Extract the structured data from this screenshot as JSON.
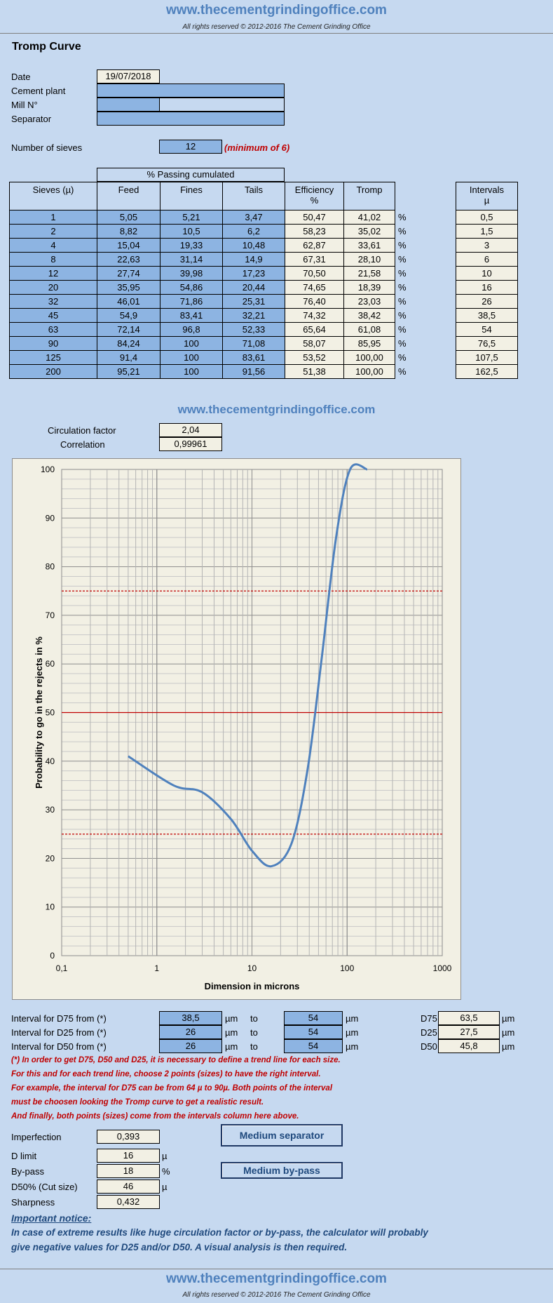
{
  "header": {
    "url": "www.thecementgrindingoffice.com",
    "copyright": "All rights reserved © 2012-2016 The Cement Grinding Office"
  },
  "title": "Tromp Curve",
  "info": {
    "date_label": "Date",
    "date_value": "19/07/2018",
    "plant_label": "Cement plant",
    "plant_value": "",
    "mill_label": "Mill N°",
    "mill_value": "",
    "separator_label": "Separator",
    "separator_value": ""
  },
  "sieves": {
    "label": "Number of sieves",
    "value": "12",
    "note": "(minimum of 6)"
  },
  "table": {
    "group_header": "% Passing cumulated",
    "headers": {
      "sieves": "Sieves (µ)",
      "feed": "Feed",
      "fines": "Fines",
      "tails": "Tails",
      "efficiency": "Efficiency",
      "efficiency_unit": "%",
      "tromp": "Tromp",
      "intervals": "Intervals",
      "intervals_unit": "µ"
    },
    "pct": "%",
    "rows": [
      {
        "sieve": "1",
        "feed": "5,05",
        "fines": "5,21",
        "tails": "3,47",
        "eff": "50,47",
        "tromp": "41,02",
        "interval": "0,5"
      },
      {
        "sieve": "2",
        "feed": "8,82",
        "fines": "10,5",
        "tails": "6,2",
        "eff": "58,23",
        "tromp": "35,02",
        "interval": "1,5"
      },
      {
        "sieve": "4",
        "feed": "15,04",
        "fines": "19,33",
        "tails": "10,48",
        "eff": "62,87",
        "tromp": "33,61",
        "interval": "3"
      },
      {
        "sieve": "8",
        "feed": "22,63",
        "fines": "31,14",
        "tails": "14,9",
        "eff": "67,31",
        "tromp": "28,10",
        "interval": "6"
      },
      {
        "sieve": "12",
        "feed": "27,74",
        "fines": "39,98",
        "tails": "17,23",
        "eff": "70,50",
        "tromp": "21,58",
        "interval": "10"
      },
      {
        "sieve": "20",
        "feed": "35,95",
        "fines": "54,86",
        "tails": "20,44",
        "eff": "74,65",
        "tromp": "18,39",
        "interval": "16"
      },
      {
        "sieve": "32",
        "feed": "46,01",
        "fines": "71,86",
        "tails": "25,31",
        "eff": "76,40",
        "tromp": "23,03",
        "interval": "26"
      },
      {
        "sieve": "45",
        "feed": "54,9",
        "fines": "83,41",
        "tails": "32,21",
        "eff": "74,32",
        "tromp": "38,42",
        "interval": "38,5"
      },
      {
        "sieve": "63",
        "feed": "72,14",
        "fines": "96,8",
        "tails": "52,33",
        "eff": "65,64",
        "tromp": "61,08",
        "interval": "54"
      },
      {
        "sieve": "90",
        "feed": "84,24",
        "fines": "100",
        "tails": "71,08",
        "eff": "58,07",
        "tromp": "85,95",
        "interval": "76,5"
      },
      {
        "sieve": "125",
        "feed": "91,4",
        "fines": "100",
        "tails": "83,61",
        "eff": "53,52",
        "tromp": "100,00",
        "interval": "107,5"
      },
      {
        "sieve": "200",
        "feed": "95,21",
        "fines": "100",
        "tails": "91,56",
        "eff": "51,38",
        "tromp": "100,00",
        "interval": "162,5"
      }
    ]
  },
  "mid_url": "www.thecementgrindingoffice.com",
  "factors": {
    "circ_label": "Circulation factor",
    "circ_value": "2,04",
    "corr_label": "Correlation",
    "corr_value": "0,99961"
  },
  "chart_data": {
    "type": "line",
    "title": "",
    "xlabel": "Dimension in microns",
    "ylabel": "Probability to go in the rejects in %",
    "x_scale": "log",
    "xlim": [
      0.1,
      1000
    ],
    "ylim": [
      0,
      100
    ],
    "x_ticks": [
      "0,1",
      "1",
      "10",
      "100",
      "1000"
    ],
    "y_ticks": [
      "0",
      "10",
      "20",
      "30",
      "40",
      "50",
      "60",
      "70",
      "80",
      "90",
      "100"
    ],
    "grid": true,
    "reference_lines": [
      25,
      50,
      75
    ],
    "colors": {
      "curve": "#4f81bd",
      "reference": "#c00000",
      "plot_bg": "#f2f0e4"
    },
    "series": [
      {
        "x": [
          0.5,
          1.5,
          3,
          6,
          10,
          16,
          26,
          38.5,
          54,
          76.5,
          107.5,
          162.5
        ],
        "y": [
          41.02,
          35.02,
          33.61,
          28.1,
          21.58,
          18.39,
          23.03,
          38.42,
          61.08,
          85.95,
          100.0,
          100.0
        ]
      }
    ]
  },
  "intervals": {
    "d75_label": "Interval for D75 from (*)",
    "d75_from": "38,5",
    "d75_to": "54",
    "d25_label": "Interval for D25 from (*)",
    "d25_from": "26",
    "d25_to": "54",
    "d50_label": "Interval for D50 from (*)",
    "d50_from": "26",
    "d50_to": "54",
    "unit": "µm",
    "to": "to",
    "d75_name": "D75",
    "d75_value": "63,5",
    "d25_name": "D25",
    "d25_value": "27,5",
    "d50_name": "D50",
    "d50_value": "45,8"
  },
  "notes": [
    "(*) In order to get D75, D50 and D25, it is necessary to define a trend line for each size.",
    "For this and for each trend line, choose 2 points (sizes) to have the right interval.",
    "For example, the interval for D75 can be from 64 µ to 90µ. Both points of the interval",
    "must be choosen looking the Tromp curve to get a realistic result.",
    "And finally, both points (sizes) come from the intervals column here above."
  ],
  "results": {
    "imperfection_label": "Imperfection",
    "imperfection_value": "0,393",
    "dlimit_label": "D limit",
    "dlimit_value": "16",
    "dlimit_unit": "µ",
    "bypass_label": "By-pass",
    "bypass_value": "18",
    "bypass_unit": "%",
    "d50_label": "D50% (Cut size)",
    "d50_value": "46",
    "d50_unit": "µ",
    "sharpness_label": "Sharpness",
    "sharpness_value": "0,432",
    "separator_button": "Medium separator",
    "bypass_button": "Medium by-pass"
  },
  "notice": {
    "title": "Important notice:",
    "line1": "In case of extreme results like huge circulation factor or by-pass, the calculator will probably",
    "line2": "give negative values for D25 and/or D50. A visual analysis is then required."
  },
  "footer": {
    "url": "www.thecementgrindingoffice.com",
    "copyright": "All rights reserved © 2012-2016 The Cement Grinding Office"
  }
}
